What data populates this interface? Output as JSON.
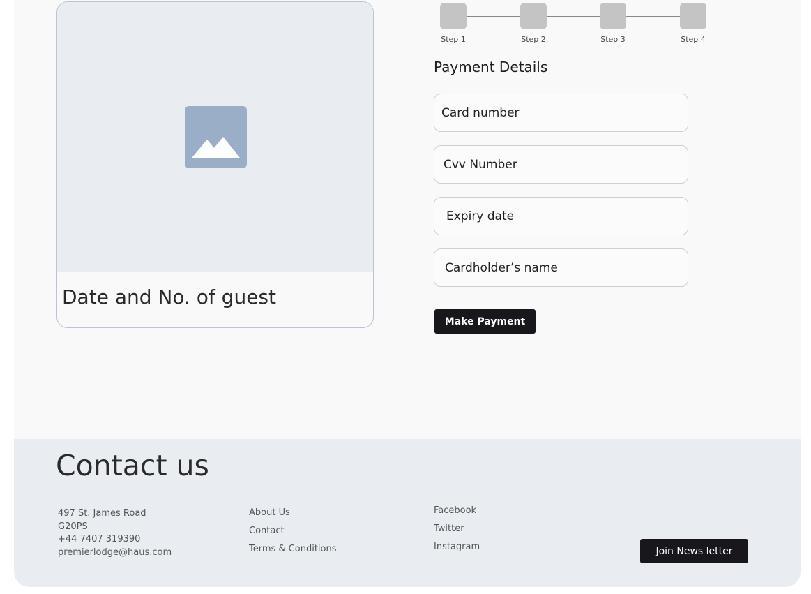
{
  "card": {
    "image_icon": "image-placeholder-icon",
    "title": "Date and No. of guest"
  },
  "steps": [
    {
      "label": "Step 1"
    },
    {
      "label": "Step 2"
    },
    {
      "label": "Step 3"
    },
    {
      "label": "Step 4"
    }
  ],
  "payment": {
    "title": "Payment Details",
    "card_number_placeholder": "Card number",
    "cvv_placeholder": "Cvv Number",
    "expiry_placeholder": "Expiry date",
    "cardholder_placeholder": "Cardholder’s name",
    "submit_label": "Make Payment"
  },
  "footer": {
    "title": "Contact us",
    "address": {
      "street": "497 St. James Road",
      "postcode": "G20PS",
      "phone": "+44 7407 319390",
      "email": "premierlodge@haus.com"
    },
    "links": [
      "About Us",
      "Contact",
      "Terms & Conditions"
    ],
    "social": [
      "Facebook",
      "Twitter",
      "Instagram"
    ],
    "newsletter_label": "Join News letter"
  },
  "colors": {
    "background": "#f9f9f9",
    "footer_background": "#e9edf2",
    "image_background": "#e9edf2",
    "placeholder_icon": "#9aaec8",
    "step_box": "#c4c4c4",
    "button": "#17171c"
  }
}
